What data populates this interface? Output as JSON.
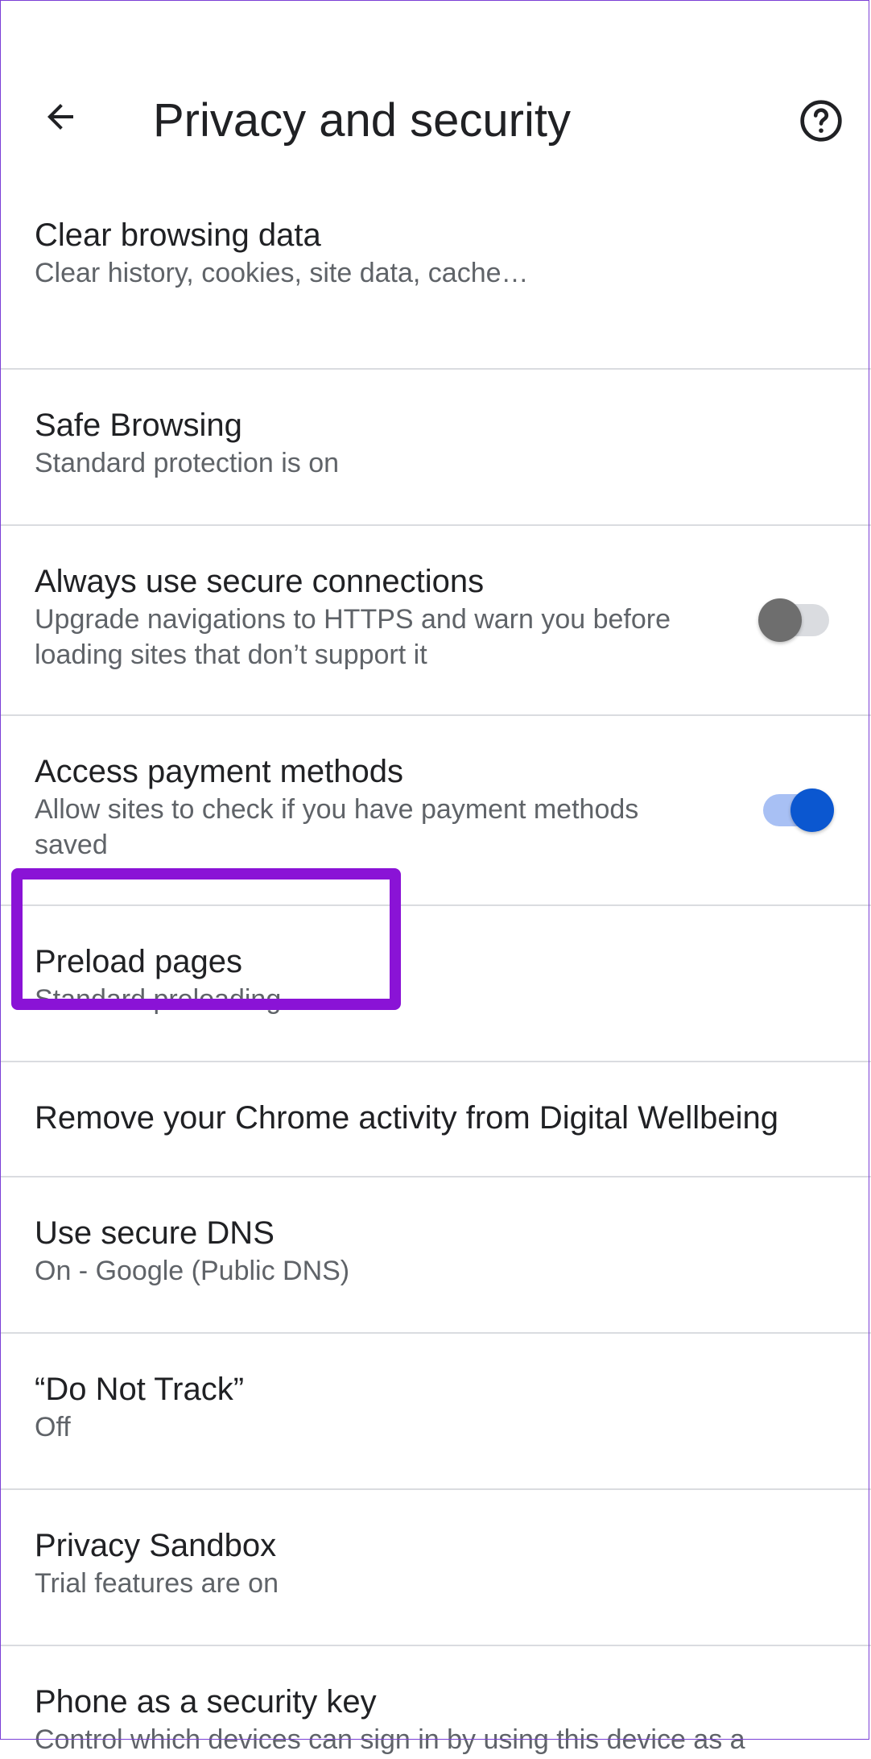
{
  "header": {
    "title": "Privacy and security",
    "back_icon": "arrow-back-icon",
    "help_icon": "help-circle-icon"
  },
  "items": [
    {
      "title": "Clear browsing data",
      "subtitle": "Clear history, cookies, site data, cache…"
    },
    {
      "title": "Safe Browsing",
      "subtitle": "Standard protection is on"
    },
    {
      "title": "Always use secure connections",
      "subtitle": "Upgrade navigations to HTTPS and warn you before loading sites that don’t support it",
      "toggle": false
    },
    {
      "title": "Access payment methods",
      "subtitle": "Allow sites to check if you have payment methods saved",
      "toggle": true
    },
    {
      "title": "Preload pages",
      "subtitle": "Standard preloading"
    },
    {
      "title": "Remove your Chrome activity from Digital Wellbeing"
    },
    {
      "title": "Use secure DNS",
      "subtitle": "On - Google (Public DNS)"
    },
    {
      "title": "“Do Not Track”",
      "subtitle": "Off"
    },
    {
      "title": "Privacy Sandbox",
      "subtitle": "Trial features are on"
    },
    {
      "title": "Phone as a security key",
      "subtitle": "Control which devices can sign in by using this device as a"
    }
  ],
  "colors": {
    "highlight": "#8a13d6",
    "toggle_on": "#0b57d0",
    "toggle_off": "#6e6e6e"
  }
}
